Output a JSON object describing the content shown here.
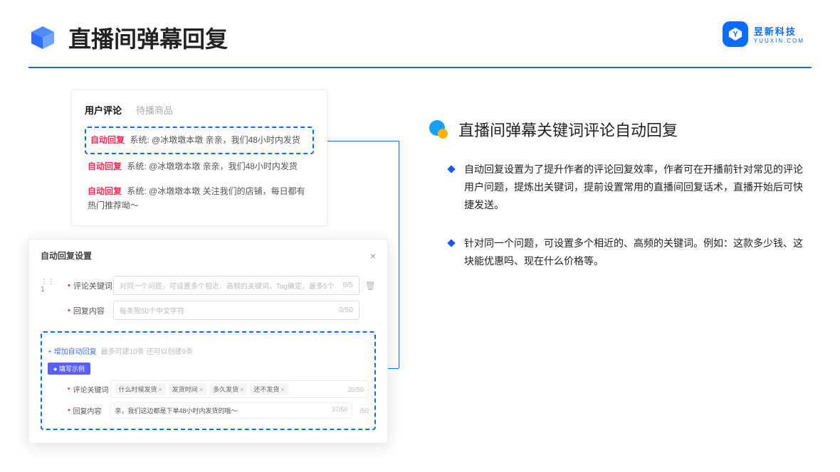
{
  "header": {
    "title": "直播间弹幕回复",
    "brand_name": "昱新科技",
    "brand_url": "YUUXIN.COM"
  },
  "comments": {
    "tab_active": "用户评论",
    "tab_other": "待播商品",
    "auto_label": "自动回复",
    "sys_label": "系统:",
    "row1": "@冰墩墩本墩 亲亲，我们48小时内发货",
    "row2": "@冰墩墩本墩 亲亲，我们48小时内发货",
    "row3": "@冰墩墩本墩 关注我们的店铺，每日都有热门推荐呦～"
  },
  "dialog": {
    "title": "自动回复设置",
    "idx": "1",
    "kw_label": "评论关键词",
    "kw_placeholder": "对同一个问题，可设置多个相近、高频的关键词，Tag确定，最多5个",
    "kw_counter": "0/5",
    "content_label": "回复内容",
    "content_placeholder": "每条限50个中文字符",
    "content_counter": "0/50",
    "add_link": "+ 增加自动回复",
    "add_hint": "最多可建10条 还可以创建9条",
    "example_badge": "● 填写示例",
    "ex_kw_label": "评论关键词",
    "ex_tags": [
      "什么时候发货",
      "发货时间",
      "多久发货",
      "还不发货"
    ],
    "ex_kw_counter": "20/50",
    "ex_content_label": "回复内容",
    "ex_content_value": "亲，我们这边都是下单48小时内发货的哦～",
    "ex_content_counter": "37/50",
    "outer_counter": "/50"
  },
  "right": {
    "section_title": "直播间弹幕关键词评论自动回复",
    "bullet1": "自动回复设置为了提升作者的评论回复效率，作者可在开播前针对常见的评论用户问题，提炼出关键词，提前设置常用的直播间回复话术，直播开始后可快捷发送。",
    "bullet2": "针对同一个问题，可设置多个相近的、高频的关键词。例如：这款多少钱、这块能优惠吗、现在什么价格等。"
  }
}
